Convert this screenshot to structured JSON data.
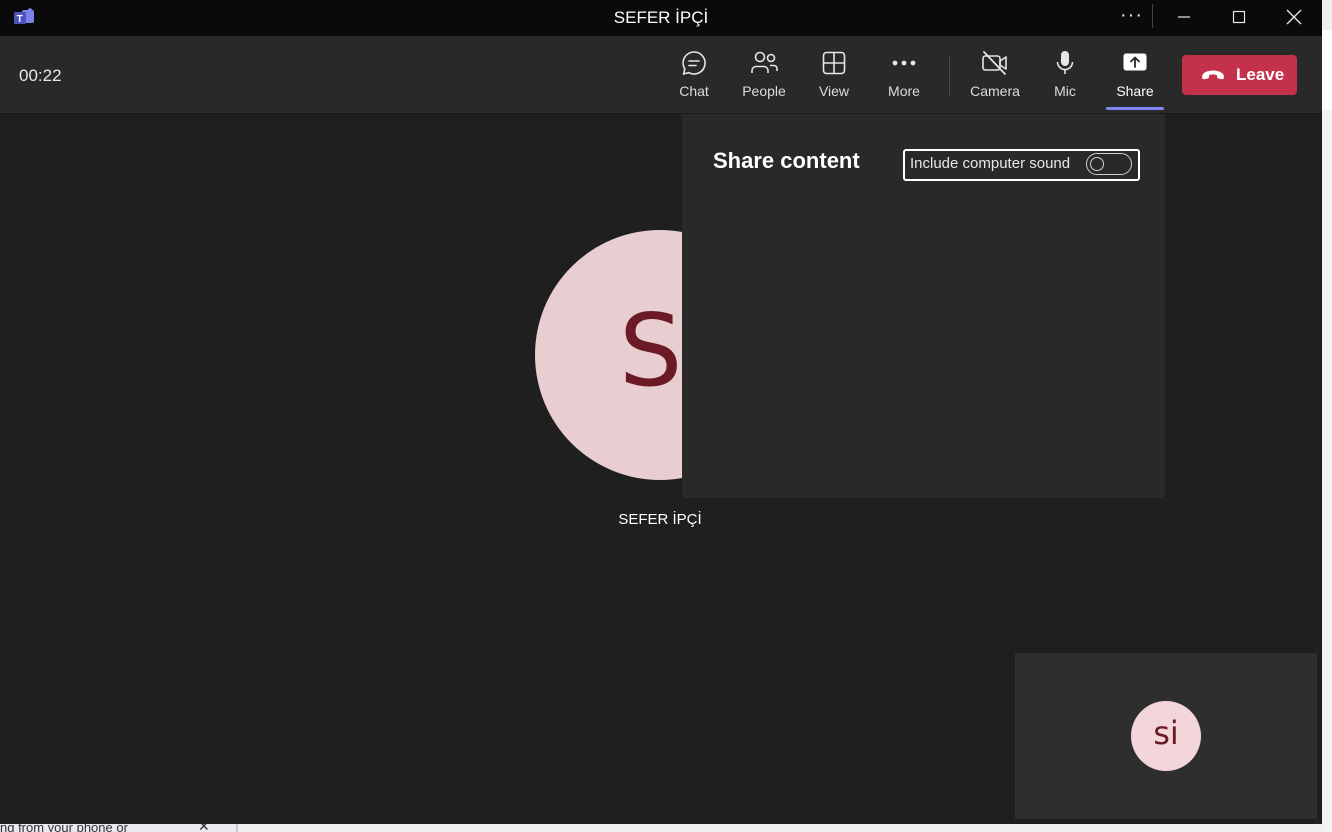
{
  "window": {
    "title": "SEFER İPÇİ"
  },
  "toolbar": {
    "timer": "00:22",
    "buttons": {
      "chat": "Chat",
      "people": "People",
      "view": "View",
      "more": "More",
      "camera": "Camera",
      "mic": "Mic",
      "share": "Share"
    },
    "leave_label": "Leave"
  },
  "stage": {
    "participant_initials": "SI",
    "participant_name": "SEFER İPÇİ",
    "self_initials": "si"
  },
  "share_panel": {
    "title": "Share content",
    "sound_label": "Include computer sound",
    "sound_enabled": false
  },
  "background": {
    "partial_text": "ng from your phone or"
  },
  "colors": {
    "leave": "#c4314b",
    "accent": "#7f85f5",
    "avatar_bg": "#e8cdd1",
    "avatar_fg": "#6b1a26"
  }
}
